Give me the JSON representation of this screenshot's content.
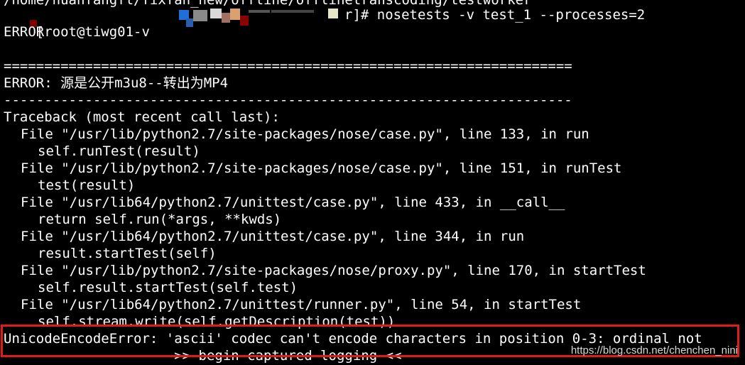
{
  "terminal": {
    "path_line": "/home/huanfangfl/fixfan_new/offline/offlinetranscoding/testworker",
    "prompt": "[root@tiwg01-v",
    "prompt_end": "r]# nosetests -v test_1 --processes=2",
    "error_status": "ERROR",
    "separator_double": "======================================================================",
    "error_title": "ERROR: 源是公开m3u8--转出为MP4",
    "separator_single": "----------------------------------------------------------------------",
    "traceback_header": "Traceback (most recent call last):",
    "frames": [
      {
        "file": "File \"/usr/lib/python2.7/site-packages/nose/case.py\", line 133, in run",
        "code": "self.runTest(result)"
      },
      {
        "file": "File \"/usr/lib/python2.7/site-packages/nose/case.py\", line 151, in runTest",
        "code": "test(result)"
      },
      {
        "file": "File \"/usr/lib64/python2.7/unittest/case.py\", line 433, in __call__",
        "code": "return self.run(*args, **kwds)"
      },
      {
        "file": "File \"/usr/lib64/python2.7/unittest/case.py\", line 344, in run",
        "code": "result.startTest(self)"
      },
      {
        "file": "File \"/usr/lib/python2.7/site-packages/nose/proxy.py\", line 170, in startTest",
        "code": "self.result.startTest(self.test)"
      },
      {
        "file": "File \"/usr/lib64/python2.7/unittest/runner.py\", line 54, in startTest",
        "code": "self.stream.write(self.getDescription(test))"
      }
    ],
    "exception_line": "UnicodeEncodeError: 'ascii' codec can't encode characters in position 0-3: ordinal not",
    "logging_line": "-------------------- >> begin captured logging << --------------------",
    "watermark": "https://blog.csdn.net/chenchen_nini"
  },
  "colors": {
    "background": "#000000",
    "text": "#ffffff",
    "highlight_border": "#e01b1b"
  }
}
